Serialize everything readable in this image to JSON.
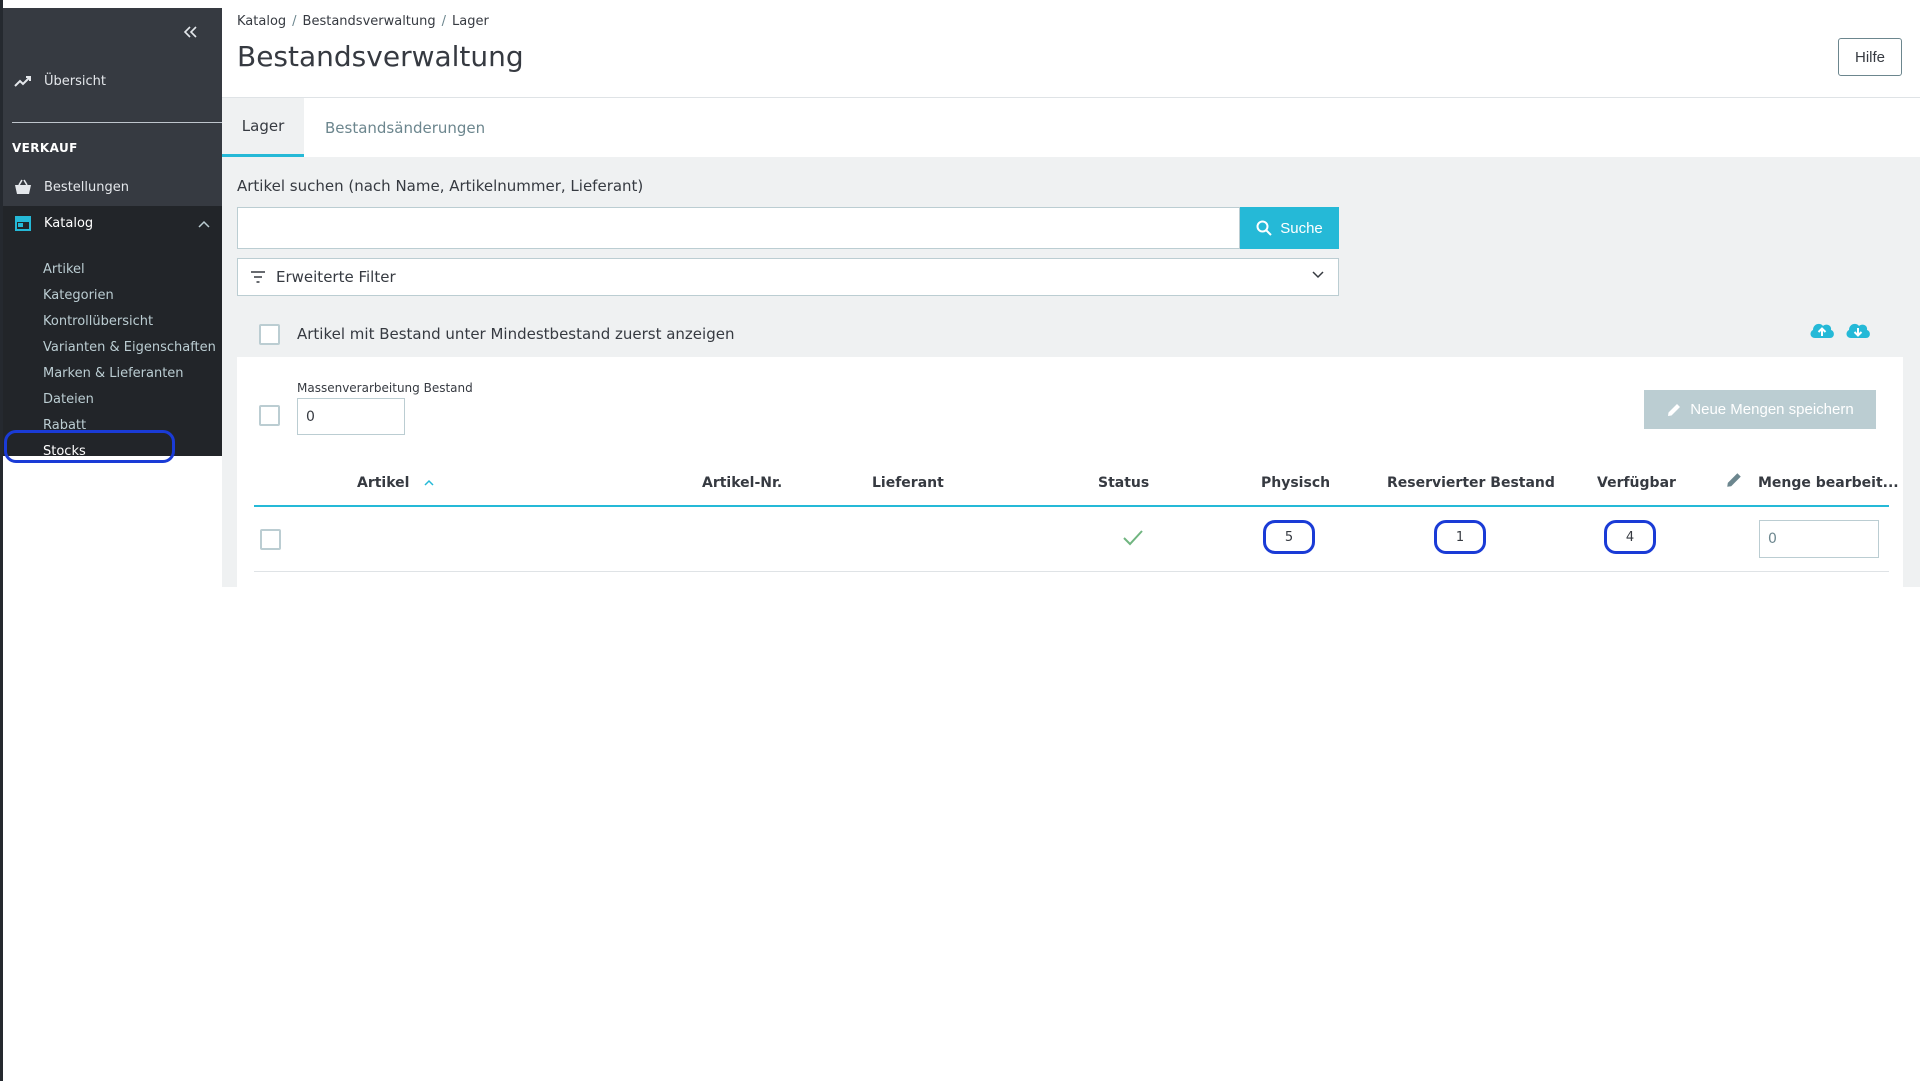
{
  "sidebar": {
    "overview": "Übersicht",
    "section_sales": "VERKAUF",
    "orders": "Bestellungen",
    "catalog": "Katalog",
    "catalog_items": [
      "Artikel",
      "Kategorien",
      "Kontrollübersicht",
      "Varianten & Eigenschaften",
      "Marken & Lieferanten",
      "Dateien",
      "Rabatt",
      "Stocks"
    ]
  },
  "header": {
    "breadcrumb": [
      "Katalog",
      "Bestandsverwaltung",
      "Lager"
    ],
    "breadcrumb_separator": "/",
    "title": "Bestandsverwaltung",
    "help_label": "Hilfe"
  },
  "tabs": {
    "active": "Lager",
    "inactive": "Bestandsänderungen"
  },
  "search": {
    "label": "Artikel suchen (nach Name, Artikelnummer, Lieferant)",
    "value": "",
    "button_label": "Suche"
  },
  "filters": {
    "label": "Erweiterte Filter"
  },
  "options": {
    "low_stock_label": "Artikel mit Bestand unter Mindestbestand zuerst anzeigen"
  },
  "bulk": {
    "label": "Massenverarbeitung Bestand",
    "value": "0",
    "save_label": "Neue Mengen speichern"
  },
  "table": {
    "columns": {
      "article": "Artikel",
      "article_no": "Artikel-Nr.",
      "supplier": "Lieferant",
      "status": "Status",
      "physical": "Physisch",
      "reserved": "Reservierter Bestand",
      "available": "Verfügbar",
      "edit_qty": "Menge bearbeit..."
    },
    "rows": [
      {
        "article": "",
        "article_no": "",
        "supplier": "",
        "physical": "5",
        "reserved": "1",
        "available": "4",
        "edit_qty": "0"
      }
    ]
  },
  "colors": {
    "accent": "#25b9d7",
    "highlight": "#1a3bd6",
    "sidebar": "#363a41",
    "success": "#70b580"
  }
}
